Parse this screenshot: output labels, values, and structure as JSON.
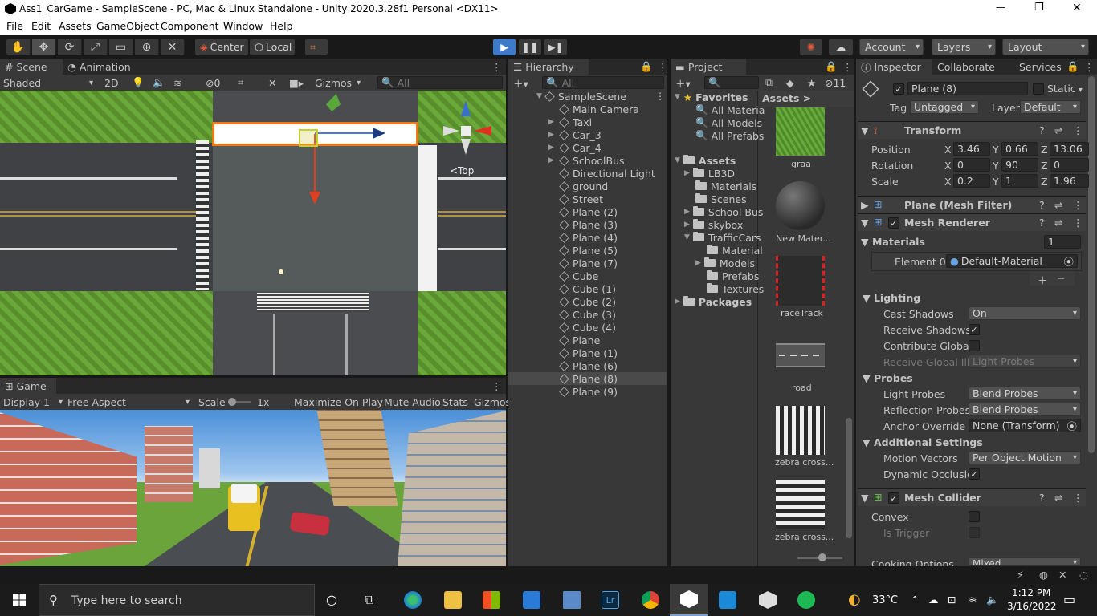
{
  "window": {
    "title": "Ass1_CarGame - SampleScene - PC, Mac & Linux Standalone - Unity 2020.3.28f1 Personal <DX11>",
    "min": "—",
    "max": "❐",
    "close": "✕"
  },
  "menu": [
    "File",
    "Edit",
    "Assets",
    "GameObject",
    "Component",
    "Window",
    "Help"
  ],
  "toolbar": {
    "center": "Center",
    "local": "Local",
    "account": "Account",
    "layers": "Layers",
    "layout": "Layout"
  },
  "scene": {
    "tab": "Scene",
    "anim_tab": "Animation",
    "shaded": "Shaded",
    "two_d": "2D",
    "fx_count": "0",
    "gizmos": "Gizmos",
    "search": "All",
    "top": "<Top"
  },
  "game": {
    "tab": "Game",
    "display": "Display 1",
    "aspect": "Free Aspect",
    "scale": "Scale",
    "scale_val": "1x",
    "maximize": "Maximize On Play",
    "mute": "Mute Audio",
    "stats": "Stats",
    "gizmos": "Gizmos"
  },
  "hierarchy": {
    "tab": "Hierarchy",
    "search": "All",
    "root": "SampleScene",
    "items": [
      "Main Camera",
      "Taxi",
      "Car_3",
      "Car_4",
      "SchoolBus",
      "Directional Light",
      "ground",
      "Street",
      "Plane (2)",
      "Plane (3)",
      "Plane (4)",
      "Plane (5)",
      "Plane (7)",
      "Cube",
      "Cube (1)",
      "Cube (2)",
      "Cube (3)",
      "Cube (4)",
      "Plane",
      "Plane (1)",
      "Plane (6)",
      "Plane (8)",
      "Plane (9)"
    ],
    "selected": "Plane (8)"
  },
  "project": {
    "tab": "Project",
    "count": "11",
    "favorites": "Favorites",
    "fav_items": [
      "All Materia",
      "All Models",
      "All Prefabs"
    ],
    "assets": "Assets",
    "folders": [
      "LB3D",
      "Materials",
      "Scenes",
      "School Bus",
      "skybox",
      "TrafficCars"
    ],
    "sub": [
      "Material",
      "Models",
      "Prefabs",
      "Textures"
    ],
    "packages": "Packages",
    "crumb": "Assets >",
    "thumbs": [
      "graa",
      "New Mater...",
      "raceTrack",
      "road",
      "zebra cross...",
      "zebra cross..."
    ]
  },
  "inspector": {
    "tab": "Inspector",
    "collab": "Collaborate",
    "services": "Services",
    "name": "Plane (8)",
    "static": "Static",
    "tag_label": "Tag",
    "tag": "Untagged",
    "layer_label": "Layer",
    "layer": "Default",
    "transform": "Transform",
    "position": "Position",
    "rotation": "Rotation",
    "scale": "Scale",
    "pos": [
      "3.46",
      "0.66",
      "13.06"
    ],
    "rot": [
      "0",
      "90",
      "0"
    ],
    "scl": [
      "0.2",
      "1",
      "1.96"
    ],
    "axes": [
      "X",
      "Y",
      "Z"
    ],
    "mesh_filter": "Plane (Mesh Filter)",
    "mesh_renderer": "Mesh Renderer",
    "materials": "Materials",
    "materials_count": "1",
    "element0": "Element 0",
    "material": "Default-Material",
    "lighting": "Lighting",
    "cast_shadows": "Cast Shadows",
    "cast_val": "On",
    "receive_shadows": "Receive Shadows",
    "contribute": "Contribute Global I",
    "receive_gi": "Receive Global Illu",
    "receive_gi_val": "Light Probes",
    "probes": "Probes",
    "light_probes": "Light Probes",
    "light_probes_val": "Blend Probes",
    "refl_probes": "Reflection Probes",
    "refl_val": "Blend Probes",
    "anchor": "Anchor Override",
    "anchor_val": "None (Transform)",
    "additional": "Additional Settings",
    "motion": "Motion Vectors",
    "motion_val": "Per Object Motion",
    "dyn_occ": "Dynamic Occlusio",
    "mesh_collider": "Mesh Collider",
    "convex": "Convex",
    "is_trigger": "Is Trigger",
    "cooking": "Cooking Options",
    "cooking_val": "Mixed"
  },
  "taskbar": {
    "search": "Type here to search",
    "temp": "33°C",
    "time": "1:12 PM",
    "date": "3/16/2022"
  },
  "colors": {
    "unity_blue": "#3d7ac8",
    "selection": "#2c5d87",
    "panel": "#383838",
    "grass": "#5f9c33"
  }
}
